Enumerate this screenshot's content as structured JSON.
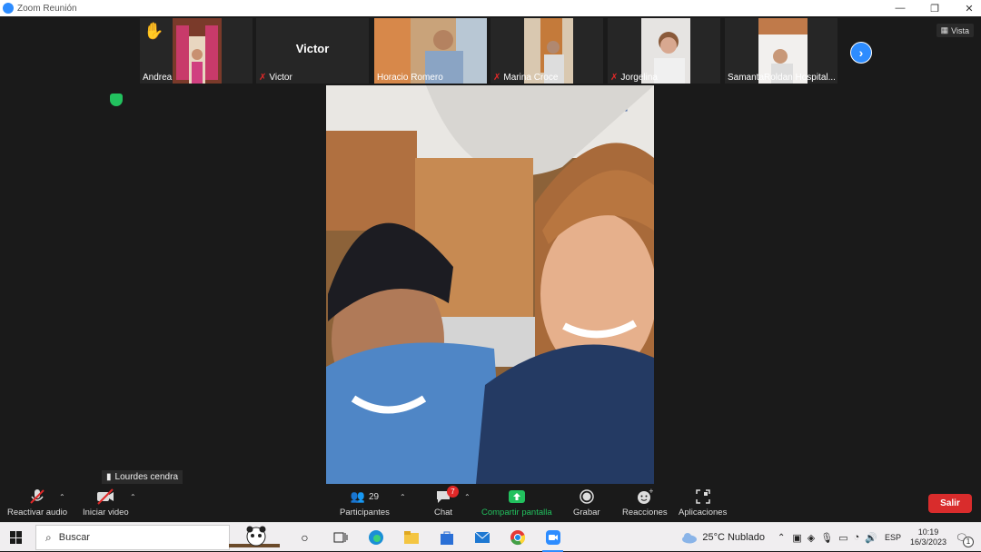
{
  "window": {
    "title": "Zoom Reunión",
    "buttons": [
      "—",
      "❐",
      "✕"
    ]
  },
  "participants_strip": [
    {
      "name": "Andrea",
      "hand_raised": true,
      "muted": false
    },
    {
      "name": "Victor",
      "display_name": "Victor",
      "muted": true
    },
    {
      "name": "Horacio Romero",
      "muted": false
    },
    {
      "name": "Marina Croce",
      "muted": true
    },
    {
      "name": "Jorgelina",
      "muted": true
    },
    {
      "name": "SamantaRoldan Hospital..."
    }
  ],
  "view_button": "Vista",
  "active_speaker": "Lourdes cendra",
  "toolbar": {
    "audio": "Reactivar audio",
    "video": "Iniciar video",
    "participants": "Participantes",
    "participants_count": "29",
    "chat": "Chat",
    "chat_badge": "7",
    "share": "Compartir pantalla",
    "record": "Grabar",
    "reactions": "Reacciones",
    "apps": "Aplicaciones",
    "leave": "Salir"
  },
  "taskbar": {
    "search_placeholder": "Buscar",
    "weather": "25°C  Nublado",
    "language": "ESP",
    "time": "10:19",
    "date": "16/3/2023",
    "notification_count": "1"
  },
  "colors": {
    "zoom_blue": "#2d8cff",
    "leave_red": "#d92c2c",
    "share_green": "#22c15e"
  }
}
